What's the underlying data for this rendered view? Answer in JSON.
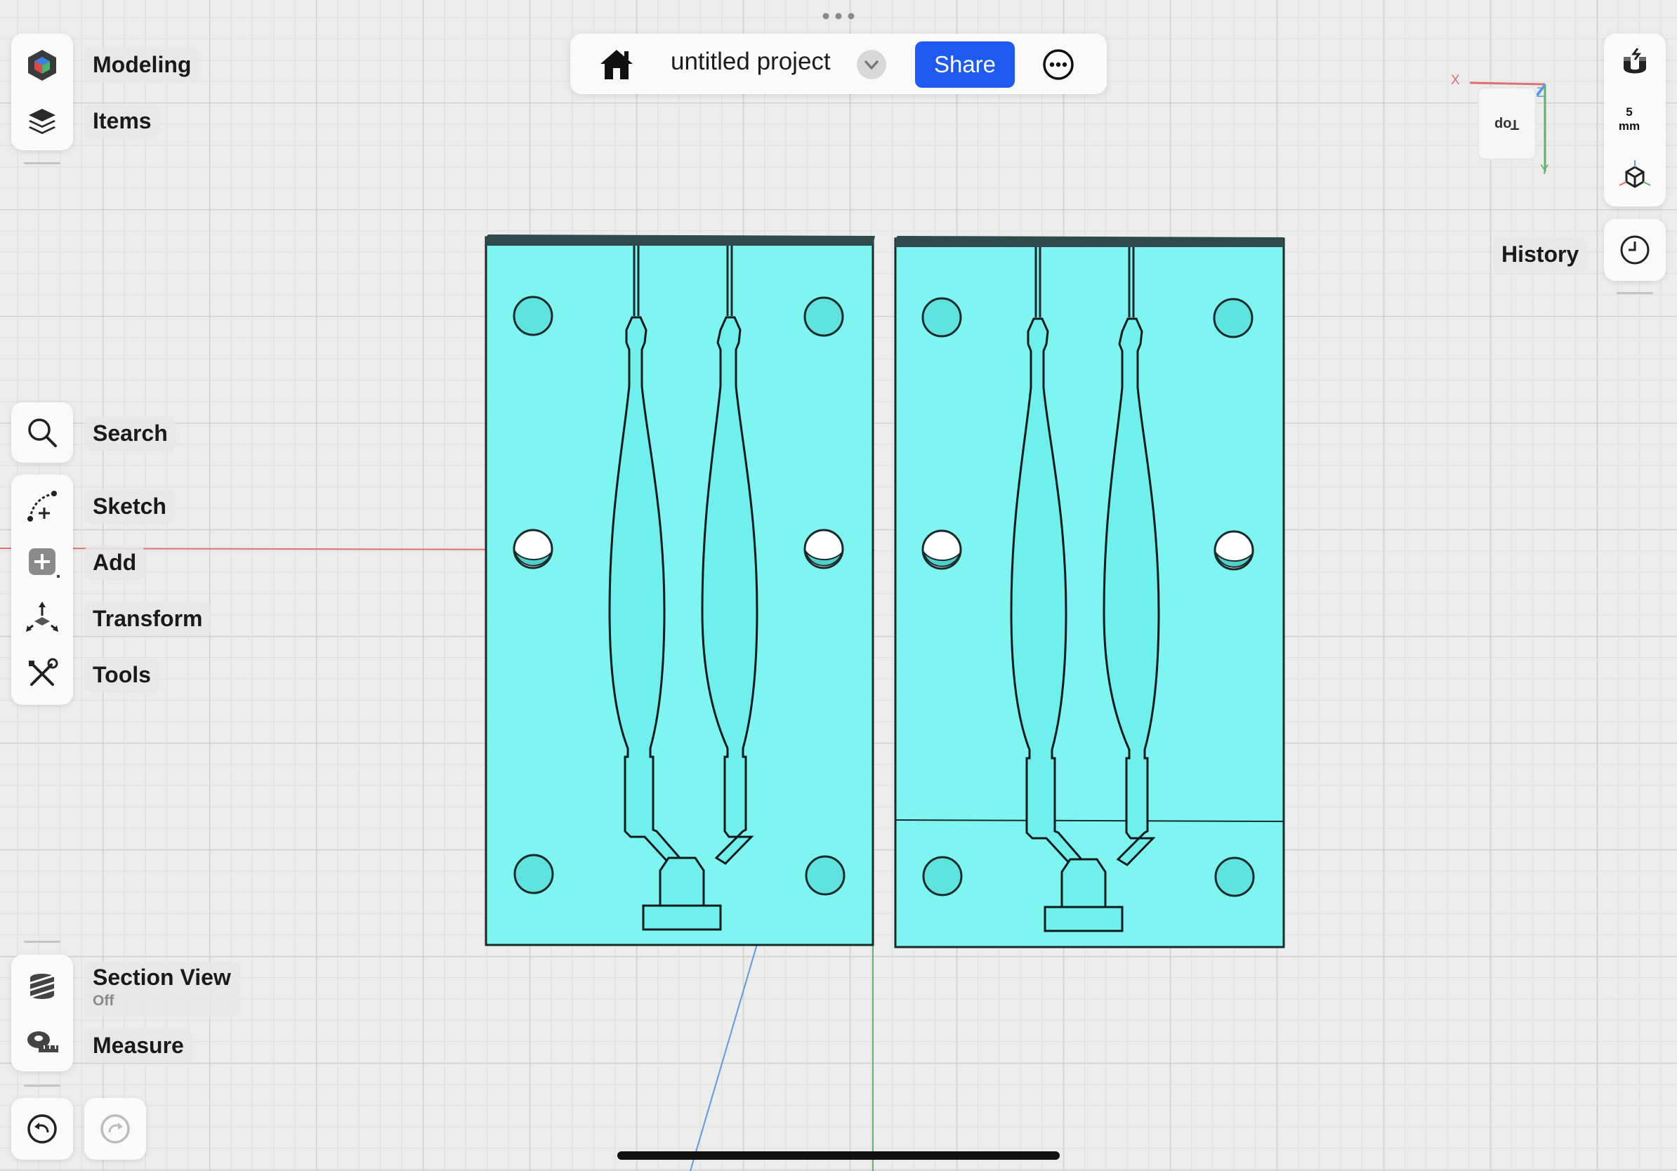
{
  "left_toolbar": {
    "top_group": [
      {
        "id": "modeling",
        "label": "Modeling",
        "icon": "modeling-cube-icon"
      },
      {
        "id": "items",
        "label": "Items",
        "icon": "layers-icon"
      }
    ],
    "search": {
      "label": "Search",
      "icon": "search-icon"
    },
    "tools_group": [
      {
        "id": "sketch",
        "label": "Sketch",
        "icon": "sketch-icon"
      },
      {
        "id": "add",
        "label": "Add",
        "icon": "add-icon"
      },
      {
        "id": "transform",
        "label": "Transform",
        "icon": "transform-icon"
      },
      {
        "id": "tools",
        "label": "Tools",
        "icon": "tools-icon"
      }
    ],
    "bottom_group": [
      {
        "id": "section_view",
        "label": "Section View",
        "sublabel": "Off",
        "icon": "section-view-icon"
      },
      {
        "id": "measure",
        "label": "Measure",
        "icon": "measure-tape-icon"
      }
    ],
    "undo_icon": "undo-icon",
    "redo_icon": "redo-icon"
  },
  "top_bar": {
    "home_icon": "home-icon",
    "project_title": "untitled project",
    "dropdown_icon": "chevron-down-icon",
    "share_label": "Share",
    "more_icon": "more-options-icon"
  },
  "right_toolbar": {
    "snap_icon": "magnet-snap-icon",
    "grid_value": "5",
    "grid_unit": "mm",
    "view_icon": "view-cube-icon",
    "history_label": "History",
    "history_icon": "clock-icon"
  },
  "view_cube": {
    "face_label": "Top",
    "axes": [
      "X",
      "Y",
      "Z"
    ]
  },
  "colors": {
    "model_fill": "#7ff5f2",
    "model_top_edge": "#2f4a4a",
    "accent": "#1f5af0",
    "x_axis": "#e07070",
    "y_axis": "#5fb36a",
    "z_axis": "#5a9ae6"
  }
}
